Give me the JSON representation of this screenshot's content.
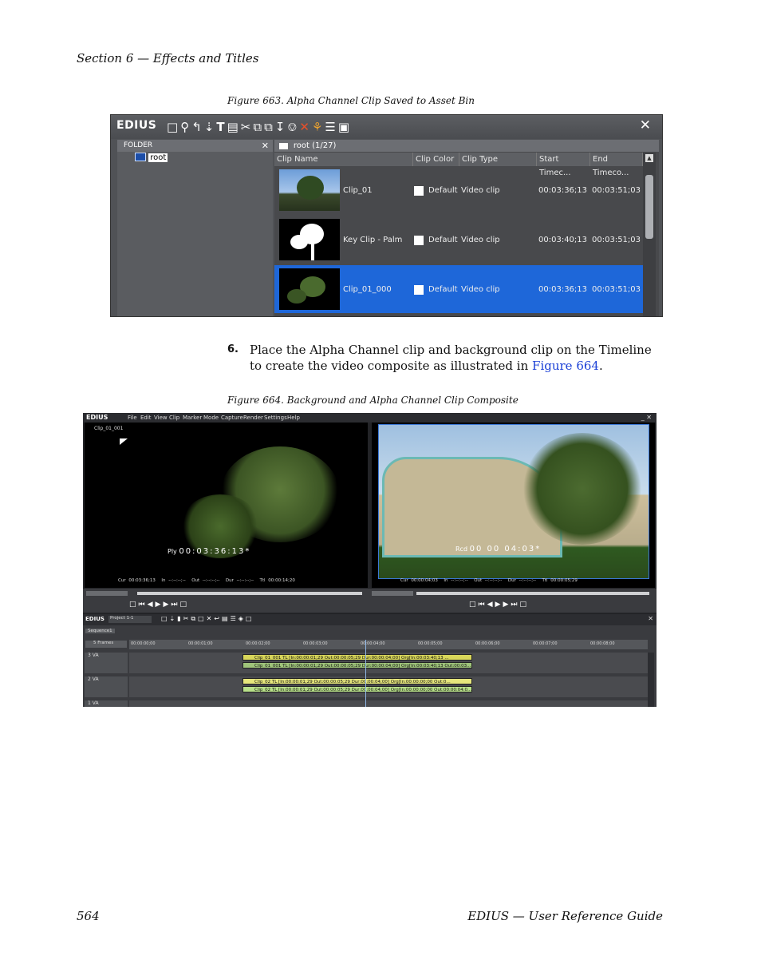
{
  "page": {
    "section_header": "Section 6 — Effects and Titles",
    "page_number": "564",
    "footer_title": "EDIUS  —  User Reference Guide"
  },
  "figure663": {
    "caption": "Figure 663.  Alpha Channel Clip Saved to Asset Bin",
    "app_logo": "EDIUS",
    "close_glyph": "✕",
    "folder_panel": {
      "title": "FOLDER",
      "close_glyph": "✕",
      "root_label": "root"
    },
    "clips_panel": {
      "title": "root (1/27)"
    },
    "columns": [
      "Clip Name",
      "Clip Color",
      "Clip Type",
      "Start Timec...",
      "End Timeco..."
    ],
    "rows": [
      {
        "name": "Clip_01",
        "color": "Default",
        "type": "Video clip",
        "start": "00:03:36;13",
        "end": "00:03:51;03",
        "selected": false
      },
      {
        "name": "Key Clip - Palm",
        "color": "Default",
        "type": "Video clip",
        "start": "00:03:40;13",
        "end": "00:03:51;03",
        "selected": false
      },
      {
        "name": "Clip_01_000",
        "color": "Default",
        "type": "Video clip",
        "start": "00:03:36;13",
        "end": "00:03:51;03",
        "selected": true
      }
    ],
    "colors": {
      "selected_row": "#1e67d9",
      "panel_bg": "#505256"
    }
  },
  "step": {
    "number": "6.",
    "text_before": "Place the Alpha Channel clip and background clip on the Timeline to create the video composite as illustrated in ",
    "link_text": "Figure 664",
    "text_after": "."
  },
  "figure664": {
    "caption": "Figure 664.  Background and Alpha Channel Clip Composite",
    "menu_logo": "EDIUS",
    "menu_items": [
      "File",
      "Edit",
      "View",
      "Clip",
      "Marker",
      "Mode",
      "Capture",
      "Render",
      "Settings",
      "Help"
    ],
    "window_controls": "_ ✕",
    "player": {
      "clip_label": "Clip_01_001",
      "mode": "Ply",
      "timecode": "00:03:36:13*",
      "cur": "Cur 00:03:36;13",
      "in": "In --:--:--;--",
      "out": "Out --:--:--;--",
      "dur": "Dur --:--:--;--",
      "ttl": "Ttl 00:00:14;20"
    },
    "recorder": {
      "mode": "Rcd",
      "timecode": "00 00 04:03*",
      "cur": "Cur 00:00:04;03",
      "in": "In --:--:--;--",
      "out": "Out --:--:--;--",
      "dur": "Dur --:--:--;--",
      "ttl": "Ttl 00:00:05;29"
    },
    "timeline": {
      "logo": "EDIUS",
      "project": "Project 1-1",
      "sequence_tab": "Sequence1",
      "scale": "5 Frames",
      "ruler_ticks": [
        "00:00:00;00",
        "00:00:01;00",
        "00:00:02;00",
        "00:00:03;00",
        "00:00:04;00",
        "00:00:05;00",
        "00:00:06;00",
        "00:00:07;00",
        "00:00:08;00"
      ],
      "tracks": [
        "3 VA",
        "2 VA",
        "1 VA"
      ],
      "clips": [
        "Clip_01_001  TL [In:00:00:01;29 Out:00:00:05;29 Dur:00:00:04;00]  Org[In:00:03:40;13 ...",
        "Clip_01_001  TL [In:00:00:01;29 Out:00:00:05;29 Dur:00:00:04;00]  Org[In:00:03:40;13 Out:00:03...",
        "Clip_02  TL [In:00:00:01;29 Out:00:00:05;29 Dur:00:00:04;00]  Org[In:00:00:00;00 Out:0...",
        "Clip_02  TL [In:00:00:01;29 Out:00:00:05;29 Dur:00:00:04;00]  Org[In:00:00:00;00 Out:00:00:04:0..."
      ]
    }
  }
}
